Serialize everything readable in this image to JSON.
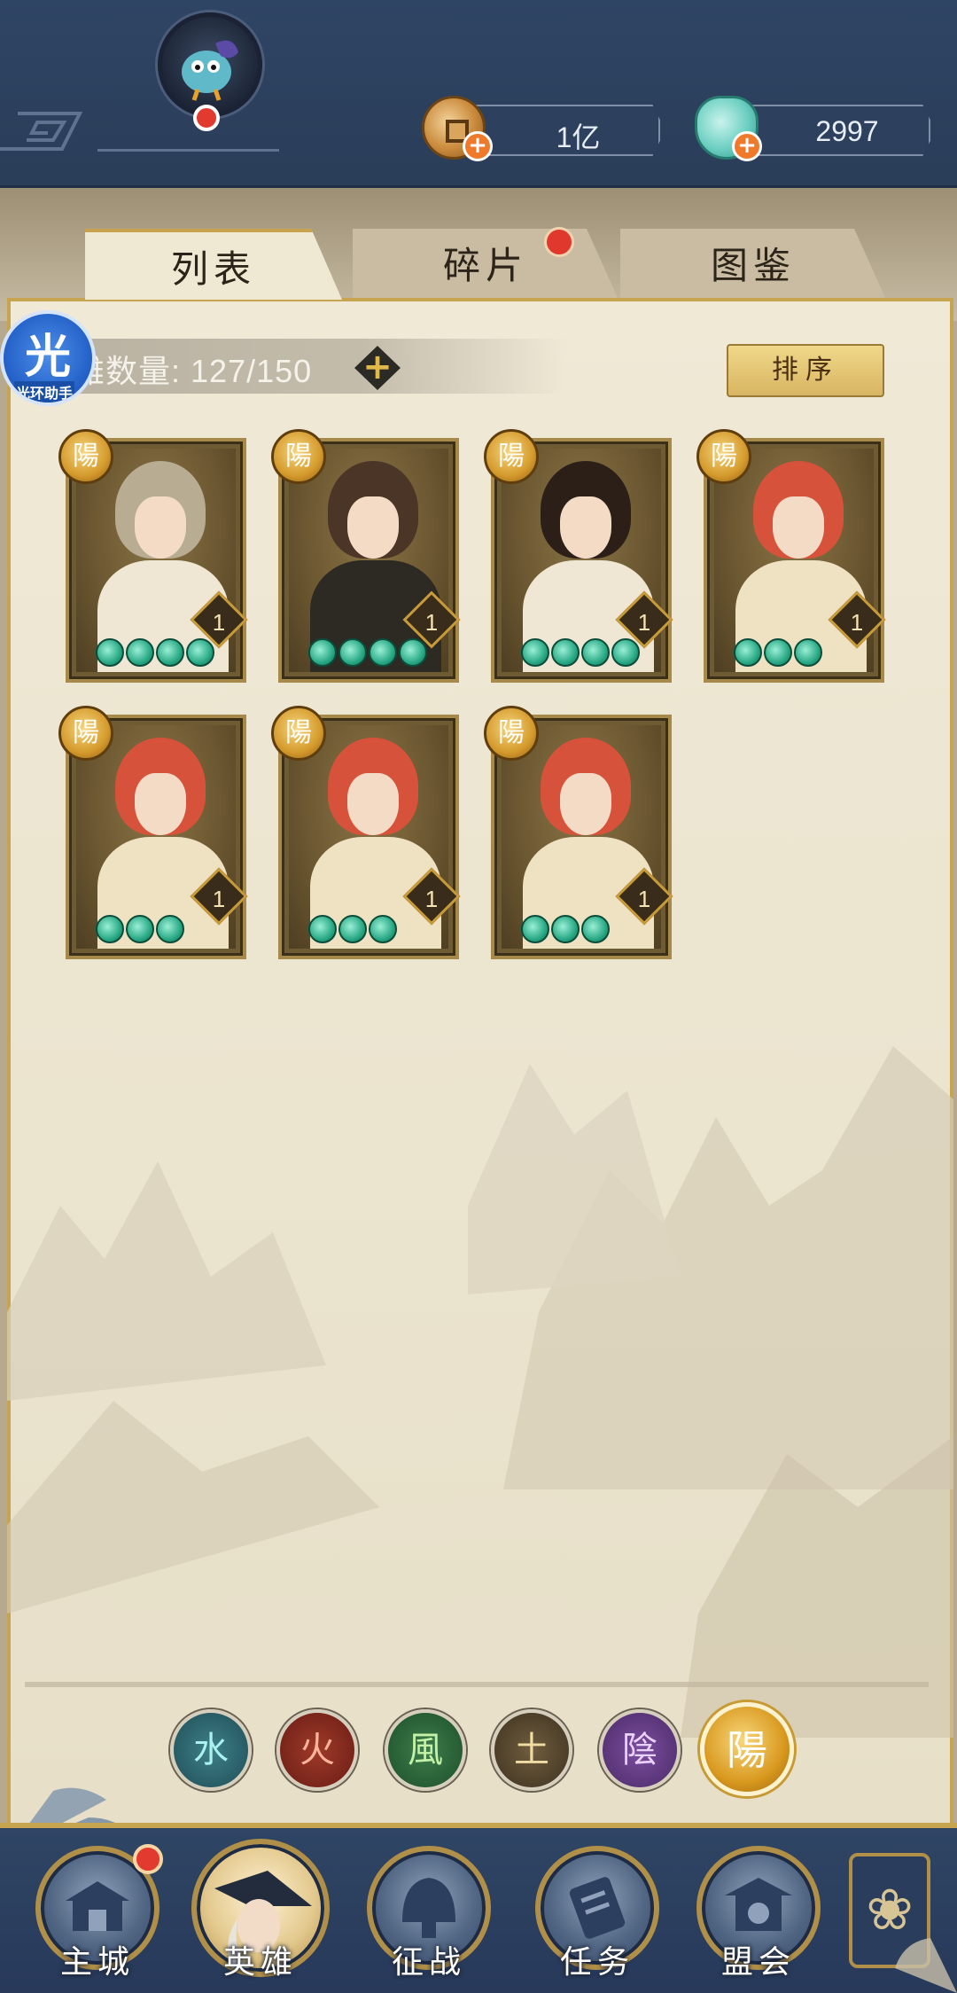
{
  "header": {
    "coins": "1亿",
    "gems": "2997",
    "plus_symbol": "+"
  },
  "tabs": [
    {
      "label": "列表",
      "active": true
    },
    {
      "label": "碎片",
      "active": false,
      "has_notification": true
    },
    {
      "label": "图鉴",
      "active": false
    }
  ],
  "hero_count": {
    "label": "雄数量: 127/150",
    "plus_symbol": "+"
  },
  "sort_button": "排序",
  "helper": {
    "glyph": "光",
    "label": "光环助手"
  },
  "heroes": [
    {
      "element": "陽",
      "level": "1",
      "stars": 4,
      "hair_color": "#b8ad92",
      "body_color": "#efe6d3"
    },
    {
      "element": "陽",
      "level": "1",
      "stars": 4,
      "hair_color": "#4a3527",
      "body_color": "#2c2a22"
    },
    {
      "element": "陽",
      "level": "1",
      "stars": 4,
      "hair_color": "#2b1f18",
      "body_color": "#efe6d3"
    },
    {
      "element": "陽",
      "level": "1",
      "stars": 3,
      "hair_color": "#d7523a",
      "body_color": "#efe2c2"
    },
    {
      "element": "陽",
      "level": "1",
      "stars": 3,
      "hair_color": "#d7523a",
      "body_color": "#efe2c2"
    },
    {
      "element": "陽",
      "level": "1",
      "stars": 3,
      "hair_color": "#d7523a",
      "body_color": "#efe2c2"
    },
    {
      "element": "陽",
      "level": "1",
      "stars": 3,
      "hair_color": "#d7523a",
      "body_color": "#efe2c2"
    }
  ],
  "element_filters": [
    {
      "glyph": "水",
      "key": "water"
    },
    {
      "glyph": "火",
      "key": "fire"
    },
    {
      "glyph": "風",
      "key": "wind"
    },
    {
      "glyph": "土",
      "key": "earth"
    },
    {
      "glyph": "陰",
      "key": "yin"
    },
    {
      "glyph": "陽",
      "key": "yang",
      "selected": true
    }
  ],
  "bottom_nav": [
    {
      "label": "主城",
      "has_notification": true
    },
    {
      "label": "英雄",
      "active": true
    },
    {
      "label": "征战"
    },
    {
      "label": "任务"
    },
    {
      "label": "盟会"
    }
  ],
  "more_glyph": "❀"
}
